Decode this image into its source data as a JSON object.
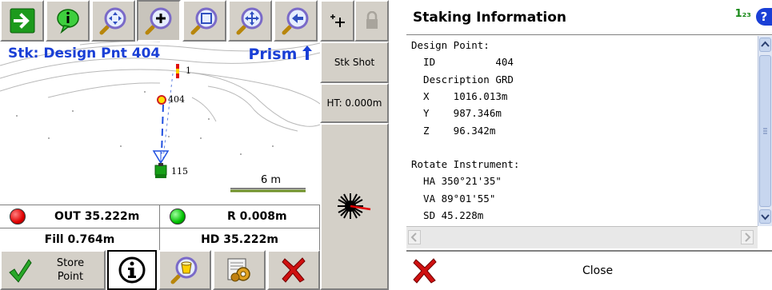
{
  "left": {
    "toolbar": {
      "buttons": [
        {
          "icon": "go-arrow-icon"
        },
        {
          "icon": "info-balloon-icon"
        },
        {
          "icon": "zoom-extents-icon"
        },
        {
          "icon": "zoom-in-icon",
          "pressed": true
        },
        {
          "icon": "zoom-window-icon"
        },
        {
          "icon": "pan-icon"
        },
        {
          "icon": "zoom-previous-icon"
        }
      ],
      "cursor_icon": "crosshair-point-icon",
      "lock_icon": "lock-icon"
    },
    "map": {
      "stake_title": "Stk: Design Pnt 404",
      "target": "Prism",
      "point_labels": {
        "design": "404",
        "instrument": "115",
        "backsight": "1"
      },
      "scale_label": "6 m"
    },
    "side_buttons": {
      "stake_shot": "Stk Shot",
      "height": "HT: 0.000m",
      "measure_icon": "laser-burst-icon"
    },
    "readouts": {
      "out": "OUT 35.222m",
      "right": "R 0.008m",
      "fill": "Fill 0.764m",
      "hd": "HD 35.222m",
      "out_dot_color": "#e00000",
      "right_dot_color": "#00c000"
    },
    "bottom_bar": {
      "store_label_1": "Store",
      "store_label_2": "Point",
      "icons": [
        "accept-check-icon",
        "info-circle-icon",
        "map-layers-icon",
        "settings-gears-icon",
        "cancel-x-icon"
      ]
    }
  },
  "right": {
    "title": "Staking Information",
    "input_mode": "1₂₃",
    "help": "?",
    "lines": [
      "Design Point:",
      "  ID          404",
      "  Description GRD",
      "  X    1016.013m",
      "  Y    987.346m",
      "  Z    96.342m",
      "",
      "Rotate Instrument:",
      "  HA 350°21'35\"",
      "  VA 89°01'55\"",
      "  SD 45.228m"
    ],
    "close_label": "Close"
  }
}
